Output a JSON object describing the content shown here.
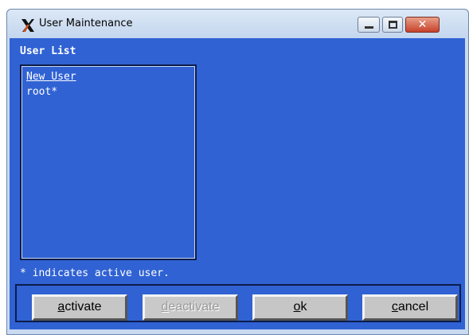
{
  "window": {
    "title": "User Maintenance",
    "controls": {
      "minimize_icon": "minimize-icon",
      "maximize_icon": "maximize-icon",
      "close_icon": "close-icon",
      "close_glyph": "✕"
    }
  },
  "user_list": {
    "heading": "User List",
    "items": [
      {
        "label": "New User",
        "selected": true
      },
      {
        "label": "root*",
        "selected": false
      }
    ]
  },
  "note": "* indicates active user.",
  "buttons": {
    "activate": {
      "mnemonic": "a",
      "rest": "ctivate",
      "enabled": true
    },
    "deactivate": {
      "mnemonic": "d",
      "rest": "eactivate",
      "enabled": false
    },
    "ok": {
      "mnemonic": "o",
      "rest": "k",
      "enabled": true
    },
    "cancel": {
      "mnemonic": "c",
      "rest": "ancel",
      "enabled": true
    }
  },
  "colors": {
    "client_background": "#3062d3",
    "button_face": "#c6c6c6",
    "close_button": "#c8412a"
  }
}
